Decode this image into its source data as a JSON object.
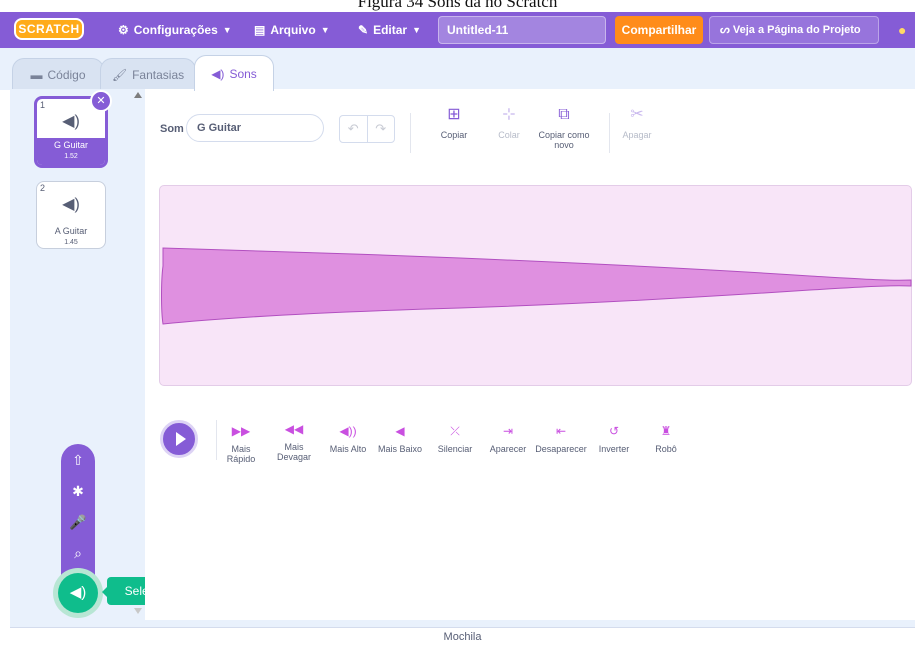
{
  "window": {
    "title_fragment": "Figura 34 Sons da no Scratch"
  },
  "menubar": {
    "logo": "SCRATCH",
    "settings_label": "Configurações",
    "file_label": "Arquivo",
    "edit_label": "Editar",
    "project_title": "Untitled-11",
    "share_label": "Compartilhar",
    "project_page_label": "Veja a Página do Projeto",
    "color": "#855cd6"
  },
  "tabs": [
    {
      "label": "Código",
      "icon": "code-icon"
    },
    {
      "label": "Fantasias",
      "icon": "brush-icon"
    },
    {
      "label": "Sons",
      "icon": "speaker-icon",
      "active": true
    }
  ],
  "sounds": [
    {
      "number": "1",
      "name": "G Guitar",
      "duration": "1.52",
      "selected": true
    },
    {
      "number": "2",
      "name": "A Guitar",
      "duration": "1.45",
      "selected": false
    }
  ],
  "editor": {
    "sound_label": "Som",
    "sound_name": "G Guitar",
    "tools": {
      "copy": "Copiar",
      "paste": "Colar",
      "copy_new": "Copiar como novo",
      "delete": "Apagar"
    },
    "waveform_color": "#d98fdc"
  },
  "effects": [
    {
      "label": "Mais Rápido",
      "icon": "faster-icon"
    },
    {
      "label": "Mais Devagar",
      "icon": "slower-icon"
    },
    {
      "label": "Mais Alto",
      "icon": "louder-icon"
    },
    {
      "label": "Mais Baixo",
      "icon": "softer-icon"
    },
    {
      "label": "Silenciar",
      "icon": "mute-icon"
    },
    {
      "label": "Aparecer",
      "icon": "fade-in-icon"
    },
    {
      "label": "Desaparecer",
      "icon": "fade-out-icon"
    },
    {
      "label": "Inverter",
      "icon": "reverse-icon"
    },
    {
      "label": "Robô",
      "icon": "robot-icon"
    }
  ],
  "add_sound": {
    "tooltip": "Selecionar um Som",
    "accent": "#0fbd8c"
  },
  "backpack": {
    "label": "Mochila"
  }
}
